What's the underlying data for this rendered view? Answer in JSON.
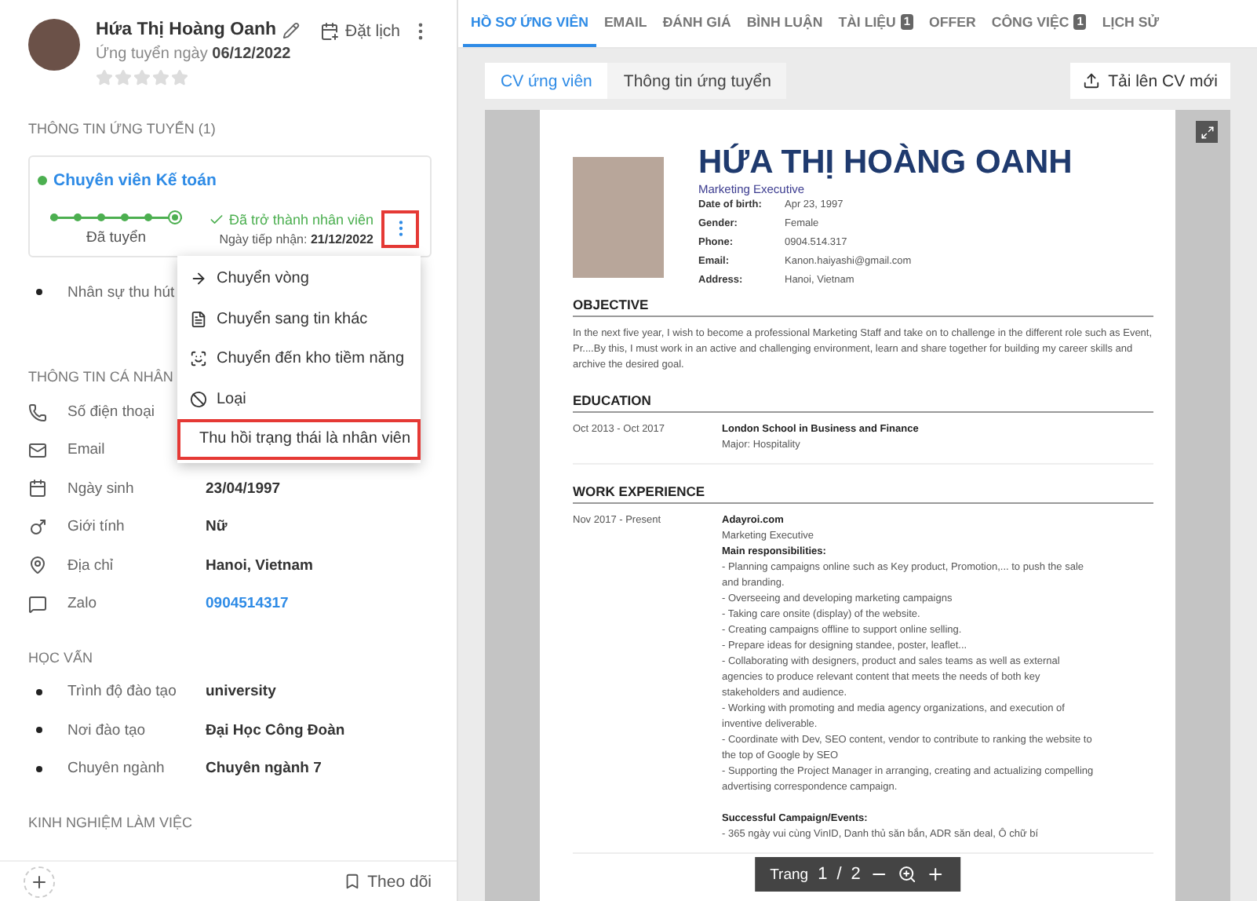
{
  "candidate": {
    "name": "Hứa Thị Hoàng Oanh",
    "applied": "Ứng tuyển ngày **06/12/2022**",
    "stars": 0,
    "schedule_label": "Đặt lịch"
  },
  "application": {
    "title": "THÔNG TIN ỨNG TUYỂN (1)",
    "job": "Chuyên viên Kế toán",
    "stage_label": "Đã tuyển",
    "status": "Đã trở thành nhân viên",
    "received": "Ngày tiếp nhận: **21/12/2022**",
    "menu_button_highlighted": true,
    "stages": [
      {
        "current": false
      },
      {
        "current": false
      },
      {
        "current": false
      },
      {
        "current": false
      },
      {
        "current": false
      },
      {
        "current": true
      }
    ],
    "extra": [
      {
        "label": "Nhân sự thu hút"
      }
    ]
  },
  "menu": [
    {
      "kind": "move",
      "label": "Chuyển vòng",
      "highlighted": false
    },
    {
      "kind": "transfer",
      "label": "Chuyển sang tin khác",
      "highlighted": false
    },
    {
      "kind": "pool",
      "label": "Chuyển đến kho tiềm năng",
      "highlighted": false
    },
    {
      "kind": "reject",
      "label": "Loại",
      "highlighted": false
    },
    {
      "kind": "revoke",
      "label": "Thu hồi trạng thái là nhân viên",
      "highlighted": true
    }
  ],
  "personal": {
    "title": "THÔNG TIN CÁ NHÂN",
    "rows": [
      {
        "kind": "phone",
        "label": "Số điện thoại"
      },
      {
        "kind": "email",
        "label": "Email"
      },
      {
        "kind": "birthday",
        "label": "Ngày sinh",
        "value": "23/04/1997",
        "link": false
      },
      {
        "kind": "gender",
        "label": "Giới tính",
        "value": "Nữ",
        "link": false
      },
      {
        "kind": "address",
        "label": "Địa chỉ",
        "value": "Hanoi, Vietnam",
        "link": false
      },
      {
        "kind": "zalo",
        "label": "Zalo",
        "value": "0904514317",
        "link": true
      }
    ]
  },
  "education": {
    "title": "HỌC VẤN",
    "rows": [
      {
        "label": "Trình độ đào tạo",
        "value": "university"
      },
      {
        "label": "Nơi đào tạo",
        "value": "Đại Học Công Đoàn"
      },
      {
        "label": "Chuyên ngành",
        "value": "Chuyên ngành 7"
      }
    ]
  },
  "experience": {
    "title": "KINH NGHIỆM LÀM VIỆC"
  },
  "footer": {
    "follow_label": "Theo dõi"
  },
  "tabs": [
    {
      "label": "HỒ SƠ ỨNG VIÊN",
      "selected": true
    },
    {
      "label": "EMAIL",
      "selected": false
    },
    {
      "label": "ĐÁNH GIÁ",
      "selected": false
    },
    {
      "label": "BÌNH LUẬN",
      "selected": false
    },
    {
      "label": "TÀI LIỆU",
      "badge": "1",
      "selected": false
    },
    {
      "label": "OFFER",
      "selected": false
    },
    {
      "label": "CÔNG VIỆC",
      "badge": "1",
      "selected": false
    },
    {
      "label": "LỊCH SỬ",
      "selected": false
    }
  ],
  "subtabs": [
    {
      "label": "CV ứng viên",
      "selected": true
    },
    {
      "label": "Thông tin ứng tuyển",
      "selected": false
    }
  ],
  "upload_button": "Tải lên CV mới",
  "cv": {
    "name": "HỨA THỊ HOÀNG OANH",
    "title": "Marketing Executive",
    "fields": [
      {
        "label": "Date of birth:",
        "value": "Apr 23, 1997"
      },
      {
        "label": "Gender:",
        "value": "Female"
      },
      {
        "label": "Phone:",
        "value": "0904.514.317"
      },
      {
        "label": "Email:",
        "value": "Kanon.haiyashi@gmail.com"
      },
      {
        "label": "Address:",
        "value": "Hanoi, Vietnam"
      }
    ],
    "objective": {
      "heading": "OBJECTIVE",
      "text": "In the next five year, I wish to become a professional Marketing Staff and take on to challenge in the different role such as Event, Pr....By this, I must work in an active and challenging environment, learn and share together for building my career skills and archive the desired goal."
    },
    "education": {
      "heading": "EDUCATION",
      "entries": [
        {
          "period": "Oct 2013 - Oct 2017",
          "school": "London School in Business and Finance",
          "major": "Major: Hospitality"
        }
      ]
    },
    "work": {
      "heading": "WORK EXPERIENCE",
      "entries": [
        {
          "period": "Nov 2017 - Present",
          "company": "Adayroi.com",
          "role": "Marketing Executive",
          "groups": [
            {
              "heading": "Main responsibilities:",
              "items": [
                "- Planning campaigns online such as Key product, Promotion,... to push the sale and branding.",
                "- Overseeing and developing marketing campaigns",
                "- Taking care onsite (display) of the website.",
                "- Creating campaigns offline to support online selling.",
                "- Prepare ideas for designing standee, poster, leaflet...",
                "- Collaborating with designers, product and sales teams as well as external agencies to produce relevant content that meets the needs of both key stakeholders and audience.",
                "- Working with promoting and media agency organizations, and execution of inventive deliverable.",
                "- Coordinate with Dev, SEO content, vendor to contribute to ranking the website to the top of Google by SEO",
                "- Supporting the Project Manager in arranging, creating and actualizing compelling advertising correspondence campaign."
              ]
            },
            {
              "heading": "Successful Campaign/Events:",
              "items": [
                "- 365 ngày vui cùng VinID, Danh thủ săn bắn, ADR săn deal, Ô chữ bí"
              ]
            }
          ]
        }
      ]
    }
  },
  "pager": {
    "label": "Trang",
    "page": "1",
    "separator": "/",
    "total": "2"
  }
}
